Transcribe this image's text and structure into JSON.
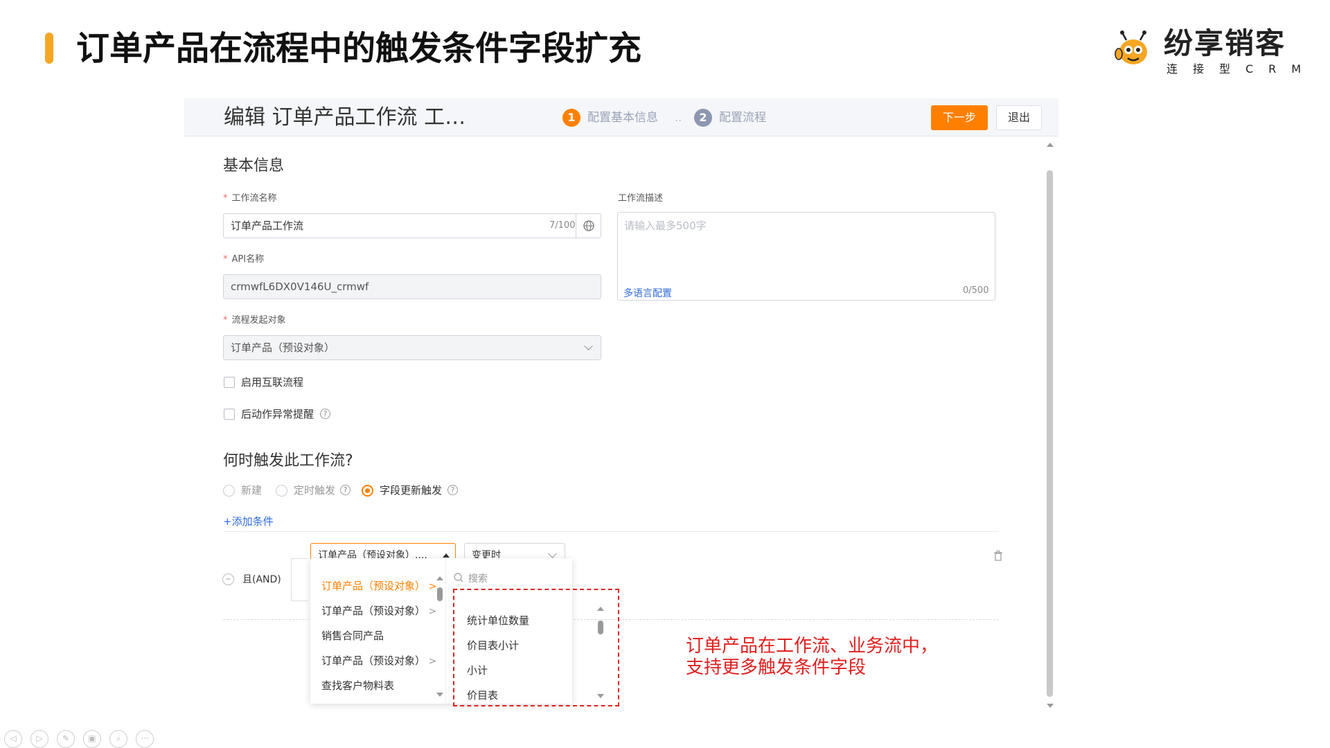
{
  "slide": {
    "title": "订单产品在流程中的触发条件字段扩充",
    "accent_color": "#f5a623",
    "logo": {
      "name": "纷享销客",
      "subtitle": "连接型CRM",
      "icon": "bee-mascot-icon"
    }
  },
  "header": {
    "title": "编辑 订单产品工作流 工…",
    "steps": [
      {
        "num": "1",
        "label": "配置基本信息",
        "color": "#ff8000"
      },
      {
        "num": "2",
        "label": "配置流程",
        "color": "#8e97b0"
      }
    ],
    "step_separator": "..",
    "next_button": "下一步",
    "exit_button": "退出",
    "accent_color": "#ff8000"
  },
  "basic_info": {
    "section_title": "基本信息",
    "workflow_name": {
      "label": "工作流名称",
      "required_mark": "*",
      "value": "订单产品工作流",
      "counter": "7/100",
      "icon": "globe-icon"
    },
    "api_name": {
      "label": "API名称",
      "required_mark": "*",
      "value": "crmwfL6DX0V146U_crmwf"
    },
    "trigger_object": {
      "label": "流程发起对象",
      "required_mark": "*",
      "value": "订单产品（预设对象）"
    },
    "description": {
      "label": "工作流描述",
      "placeholder": "请输入最多500字",
      "multilang_link": "多语言配置",
      "counter": "0/500"
    },
    "checkboxes": [
      {
        "label": "启用互联流程",
        "checked": false
      },
      {
        "label": "后动作异常提醒",
        "checked": false,
        "help": "?"
      }
    ]
  },
  "trigger": {
    "section_title": "何时触发此工作流?",
    "options": [
      {
        "label": "新建",
        "selected": false
      },
      {
        "label": "定时触发",
        "selected": false,
        "help": "?"
      },
      {
        "label": "字段更新触发",
        "selected": true,
        "help": "?"
      }
    ],
    "add_condition": "+添加条件",
    "logic_label": "且(AND)",
    "object_select": "订单产品（预设对象）....",
    "operator_select": "变更时"
  },
  "object_dropdown": {
    "items": [
      {
        "label": "订单产品（预设对象）",
        "arrow": ">",
        "active": true
      },
      {
        "label": "订单产品（预设对象）",
        "arrow": ">",
        "active": false
      },
      {
        "label": "销售合同产品",
        "arrow": "",
        "active": false
      },
      {
        "label": "订单产品（预设对象）",
        "arrow": ">",
        "active": false
      },
      {
        "label": "查找客户物料表",
        "arrow": "",
        "active": false
      }
    ]
  },
  "field_dropdown": {
    "search_placeholder": "搜索",
    "items": [
      "统计单位数量",
      "价目表小计",
      "小计",
      "价目表"
    ]
  },
  "annotation": {
    "lines": [
      "订单产品在工作流、业务流中，",
      "支持更多触发条件字段"
    ],
    "color": "#e02020"
  },
  "player_controls": [
    "◁",
    "▷",
    "✎",
    "▣",
    "⌕",
    "···"
  ]
}
